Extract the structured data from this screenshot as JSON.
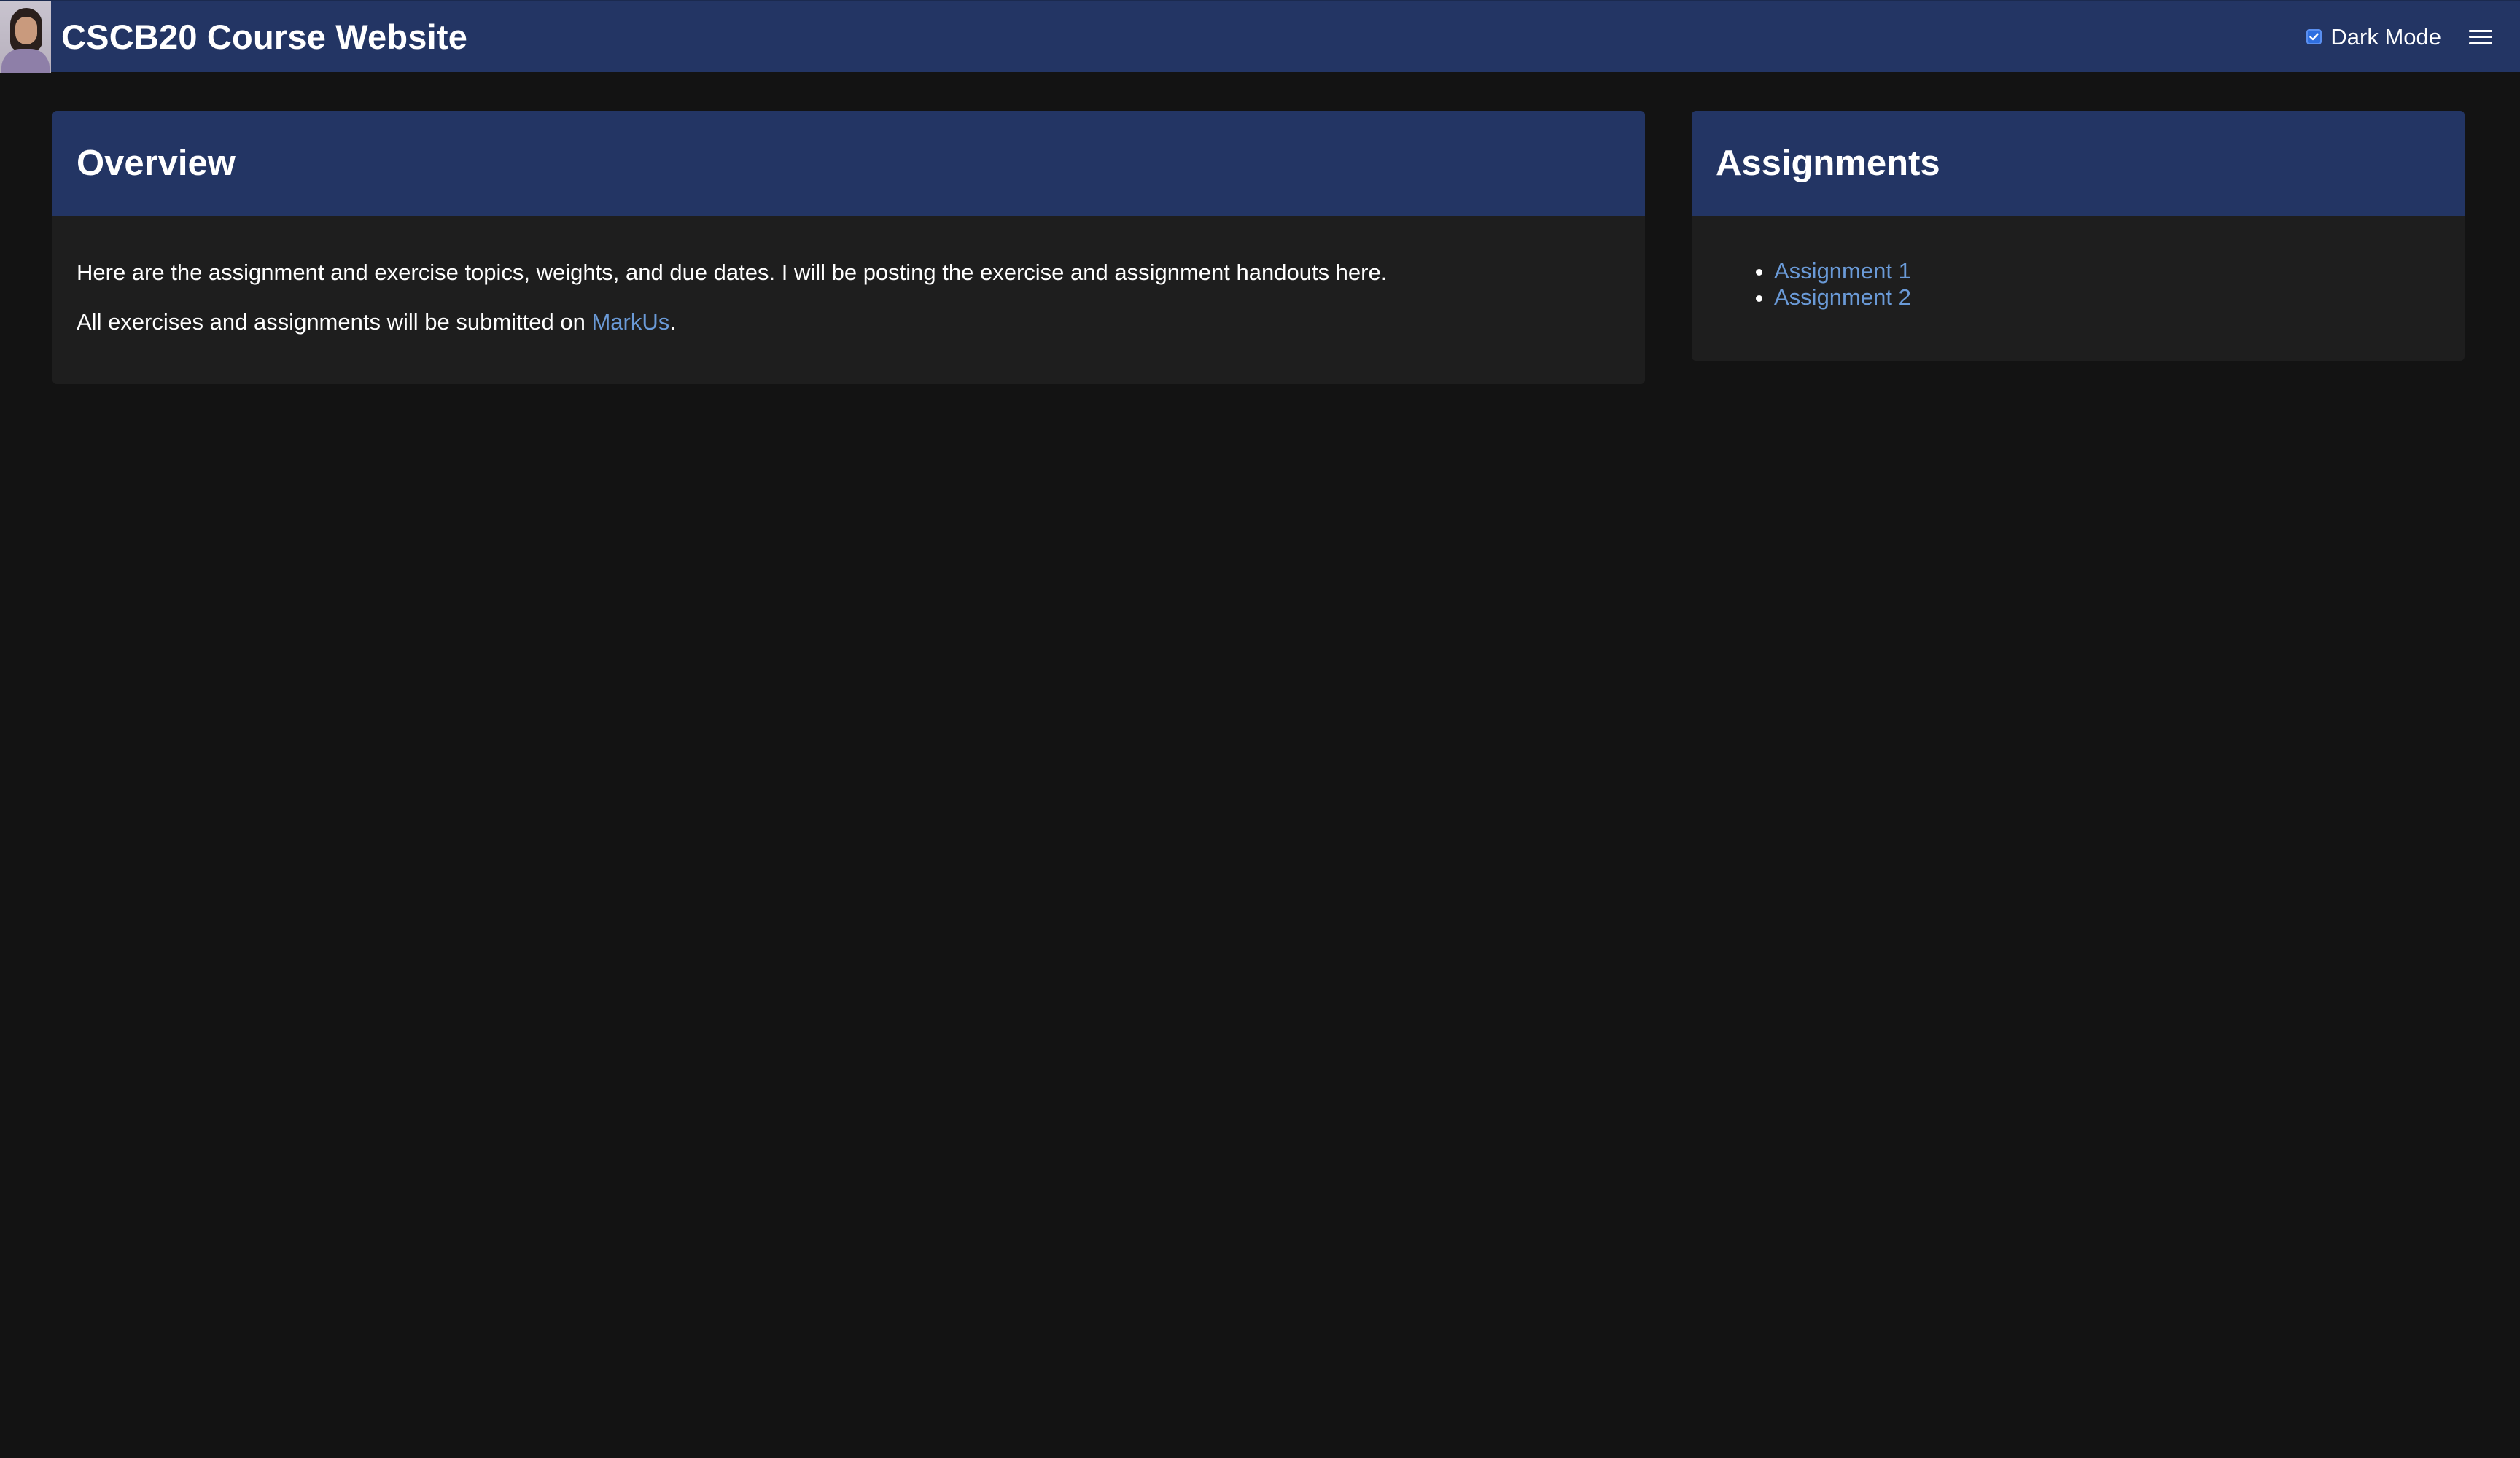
{
  "header": {
    "title": "CSCB20 Course Website",
    "dark_mode_label": "Dark Mode",
    "dark_mode_checked": true,
    "menu_icon": "hamburger-menu-icon",
    "avatar_icon": "profile-photo"
  },
  "overview": {
    "heading": "Overview",
    "paragraph1": "Here are the assignment and exercise topics, weights, and due dates. I will be posting the exercise and assignment handouts here.",
    "paragraph2_prefix": "All exercises and assignments will be submitted on ",
    "paragraph2_link": "MarkUs",
    "paragraph2_suffix": "."
  },
  "assignments": {
    "heading": "Assignments",
    "items": [
      {
        "label": "Assignment 1"
      },
      {
        "label": "Assignment 2"
      }
    ]
  },
  "colors": {
    "background": "#131313",
    "header_bg": "#233564",
    "card_bg": "#1e1e1e",
    "link": "#6a9ad7",
    "checkbox_accent": "#2f6fe0"
  }
}
